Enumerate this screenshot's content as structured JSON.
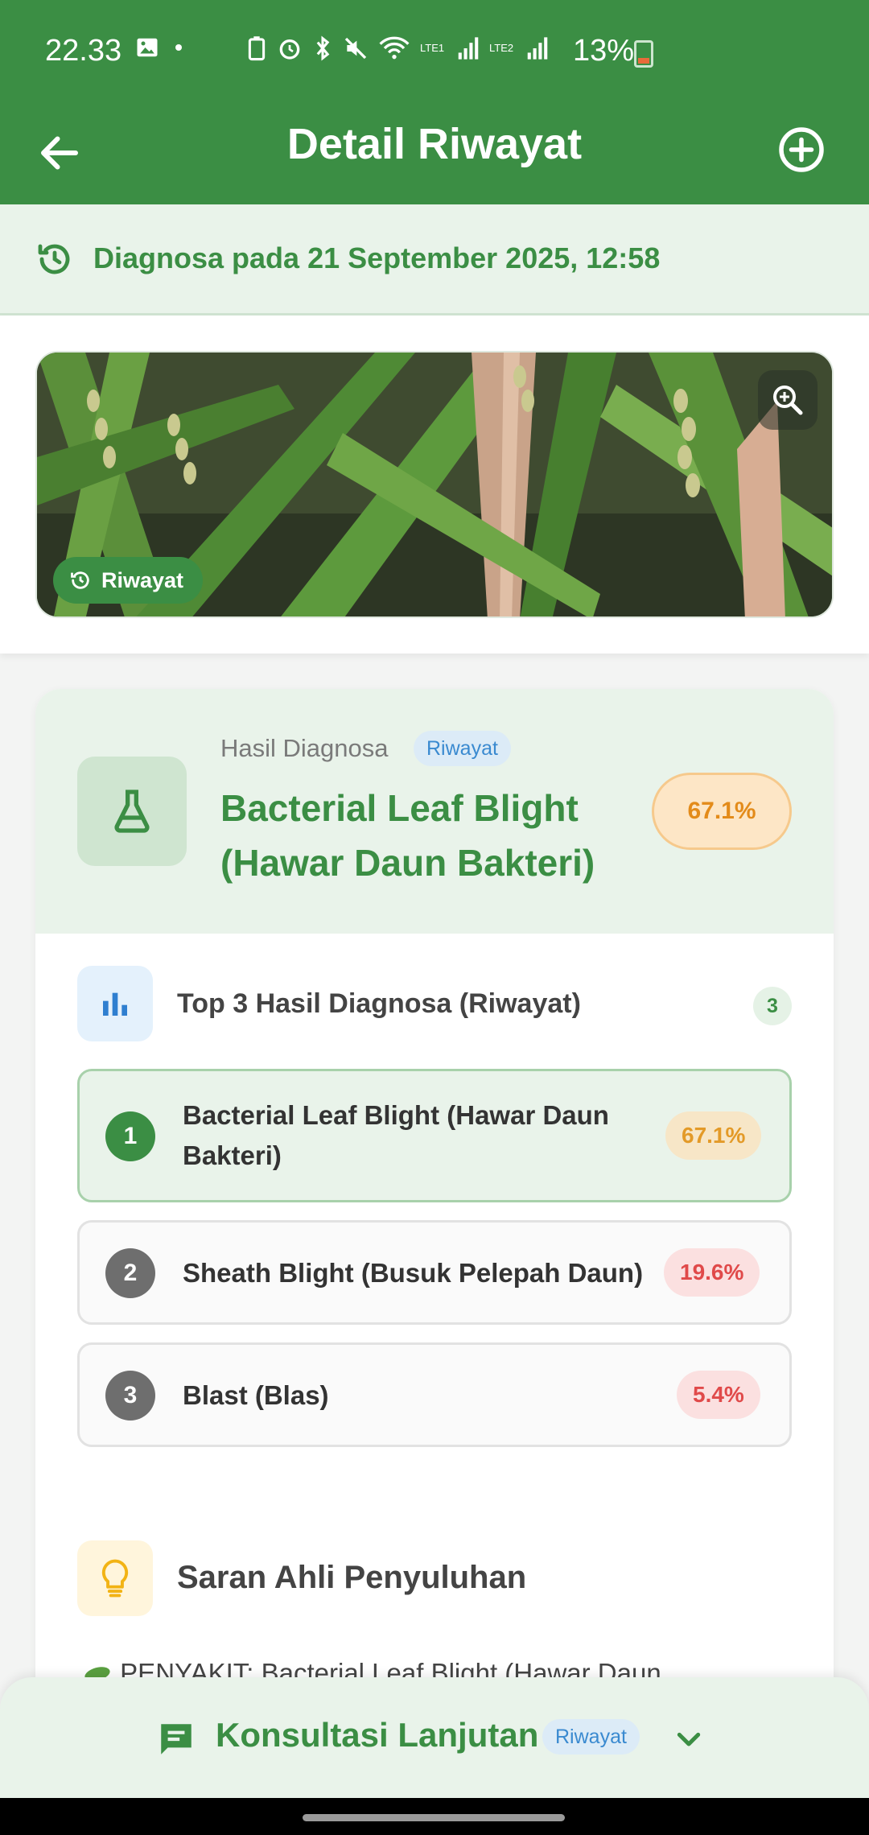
{
  "status_bar": {
    "time": "22.33",
    "battery": "13%",
    "lte1": "LTE1",
    "lte2": "LTE2"
  },
  "app_bar": {
    "title": "Detail Riwayat",
    "back_icon": "arrow-left-icon",
    "add_icon": "add-circle-icon"
  },
  "diagnosis_date": "Diagnosa pada 21 September 2025, 12:58",
  "image": {
    "badge": "Riwayat",
    "zoom_icon": "zoom-in-icon"
  },
  "result": {
    "label": "Hasil Diagnosa",
    "chip": "Riwayat",
    "disease": "Bacterial Leaf Blight (Hawar Daun Bakteri)",
    "confidence": "67.1%"
  },
  "top3": {
    "title": "Top 3 Hasil Diagnosa (Riwayat)",
    "count": "3",
    "items": [
      {
        "rank": "1",
        "name_line1": "Bacterial Leaf Blight (Hawar Daun",
        "name_line2": "Bakteri)",
        "percent": "67.1%"
      },
      {
        "rank": "2",
        "name": "Sheath Blight (Busuk Pelepah Daun)",
        "percent": "19.6%"
      },
      {
        "rank": "3",
        "name": "Blast (Blas)",
        "percent": "5.4%"
      }
    ]
  },
  "saran": {
    "title": "Saran Ahli Penyuluhan",
    "first_line": "PENYAKIT: Bacterial Leaf Blight (Hawar Daun"
  },
  "bottom_bar": {
    "label": "Konsultasi Lanjutan",
    "chip": "Riwayat"
  },
  "colors": {
    "primary": "#3b8e44",
    "light_green": "#e9f3ea",
    "amber": "#e39a28",
    "red": "#e04a4a",
    "blue": "#3a8ad0"
  }
}
